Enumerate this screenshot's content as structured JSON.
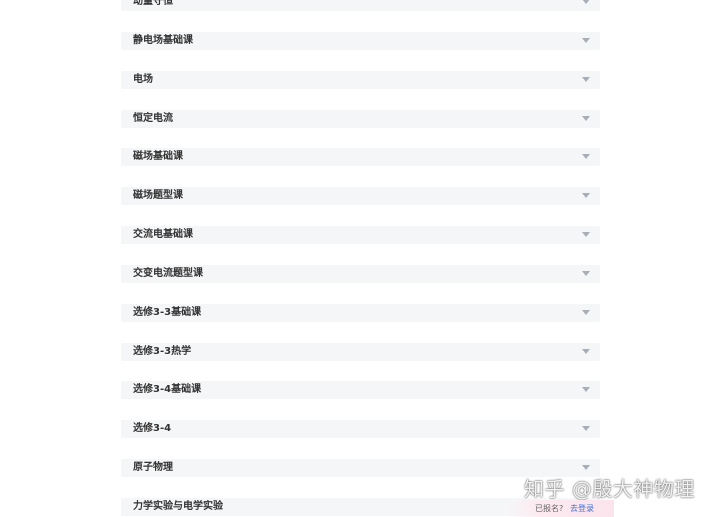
{
  "course_sections": [
    {
      "label": "动量守恒"
    },
    {
      "label": "静电场基础课"
    },
    {
      "label": "电场"
    },
    {
      "label": "恒定电流"
    },
    {
      "label": "磁场基础课"
    },
    {
      "label": "磁场题型课"
    },
    {
      "label": "交流电基础课"
    },
    {
      "label": "交变电流题型课"
    },
    {
      "label": "选修3-3基础课"
    },
    {
      "label": "选修3-3热学"
    },
    {
      "label": "选修3-4基础课"
    },
    {
      "label": "选修3-4"
    },
    {
      "label": "原子物理"
    },
    {
      "label": "力学实验与电学实验"
    }
  ],
  "expand_icon": "chevron-down-icon",
  "watermark": "知乎 @殷大神物理",
  "login": {
    "question": "已报名?",
    "link": "去登录",
    "link_color": "#3d6fd8"
  }
}
